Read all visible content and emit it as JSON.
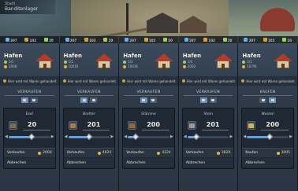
{
  "top_label": {
    "line1": "Stadt",
    "line2": "Banditenlager"
  },
  "resource_bar": [
    {
      "a": "207",
      "b": "102",
      "c": "20",
      "color_a": "#6bb0e8",
      "color_b": "#c9a24a",
      "color_c": "#9ccf6b"
    },
    {
      "a": "207",
      "b": "102",
      "c": "20",
      "color_a": "#6bb0e8",
      "color_b": "#c9a24a",
      "color_c": "#9ccf6b"
    },
    {
      "a": "207",
      "b": "102",
      "c": "20",
      "color_a": "#6bb0e8",
      "color_b": "#c9a24a",
      "color_c": "#9ccf6b"
    },
    {
      "a": "207",
      "b": "102",
      "c": "20",
      "color_a": "#6bb0e8",
      "color_b": "#c9a24a",
      "color_c": "#9ccf6b"
    },
    {
      "a": "207",
      "b": "102",
      "c": "20",
      "color_a": "#6bb0e8",
      "color_b": "#c9a24a",
      "color_c": "#9ccf6b"
    }
  ],
  "panels": [
    {
      "title": "Hafen",
      "level": "1/1",
      "gold": "2008",
      "notice": "Hier wird mit Waren gehandelt.",
      "mode": "VERKAUFEN",
      "good": "Esel",
      "quantity": "20",
      "slider_fraction": 0.55,
      "action": "Verkaufen",
      "price": "2000",
      "cancel": "Abbrechen",
      "icon_color": "#8a6a45"
    },
    {
      "title": "Hafen",
      "level": "1/1",
      "gold": "10016",
      "notice": "Hier wird mit Waren gehandelt.",
      "mode": "VERKAUFEN",
      "good": "Bretter",
      "quantity": "201",
      "slider_fraction": 0.5,
      "action": "Verkaufen",
      "price": "4624",
      "cancel": "Abbrechen",
      "icon_color": "#b07a45"
    },
    {
      "title": "Hafen",
      "level": "1/1",
      "gold": "10016",
      "notice": "Hier wird mit Waren gehandelt.",
      "mode": "VERKAUFEN",
      "good": "Stämme",
      "quantity": "200",
      "slider_fraction": 0.18,
      "action": "Verkaufen",
      "price": "4224",
      "cancel": "Abbrechen",
      "icon_color": "#8f6a3a"
    },
    {
      "title": "Hafen",
      "level": "1/1",
      "gold": "2020",
      "notice": "Hier wird mit Waren gehandelt.",
      "mode": "VERKAUFEN",
      "good": "Stein",
      "quantity": "201",
      "slider_fraction": 0.22,
      "action": "Verkaufen",
      "price": "3829",
      "cancel": "Abbrechen",
      "icon_color": "#9a9a9a"
    },
    {
      "title": "Hafen",
      "level": "1/1",
      "gold": "10791",
      "notice": "Hier wird mit Waren gehandelt.",
      "mode": "KAUFEN",
      "good": "Weizen",
      "quantity": "200",
      "slider_fraction": 0.55,
      "action": "Kaufen",
      "price": "3005",
      "cancel": "Abbrechen",
      "icon_color": "#d6b24a"
    }
  ],
  "colors": {
    "accent": "#4fa3ff",
    "gold": "#e3b341",
    "roof": "#b03c2c"
  }
}
